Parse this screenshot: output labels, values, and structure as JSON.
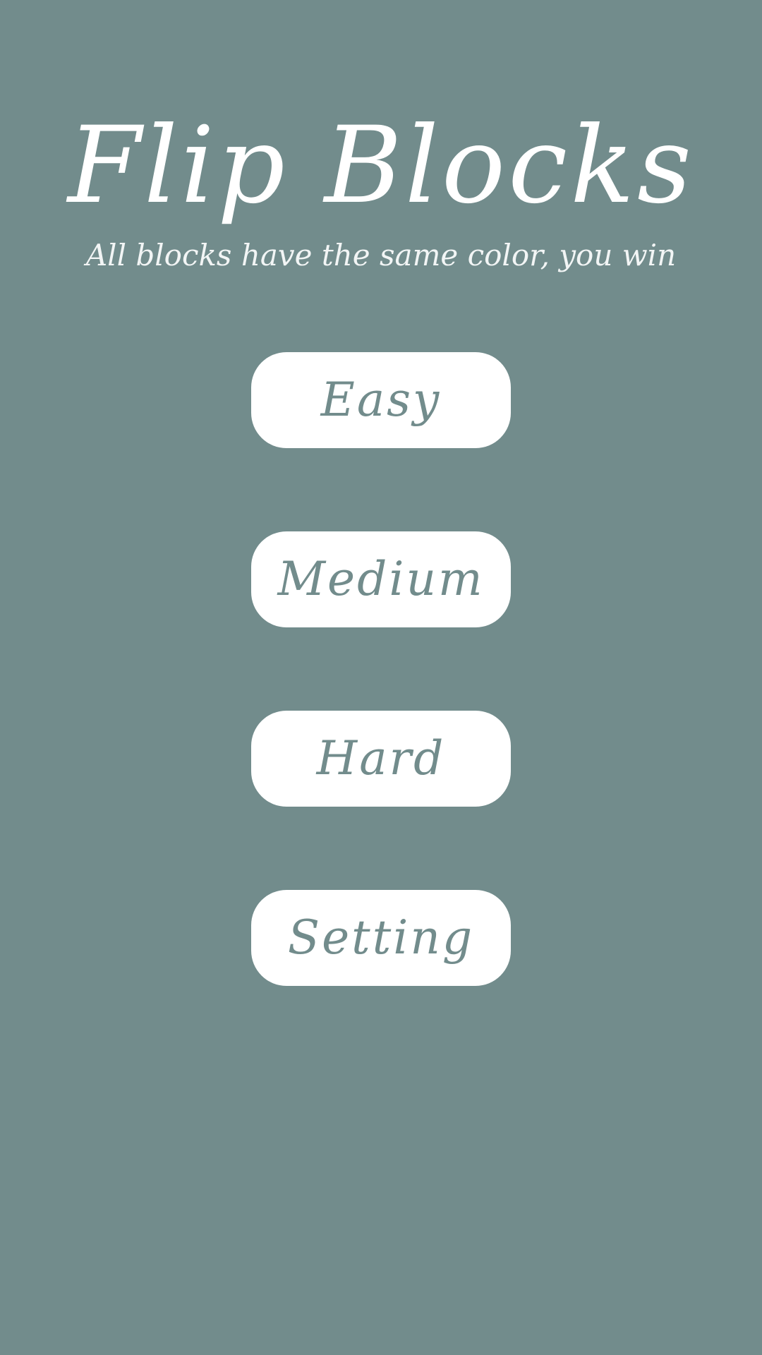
{
  "app": {
    "title": "Flip Blocks",
    "subtitle": "All blocks have the same color, you win"
  },
  "menu": {
    "easy_label": "Easy",
    "medium_label": "Medium",
    "hard_label": "Hard",
    "setting_label": "Setting"
  },
  "colors": {
    "background": "#728c8c",
    "button_background": "#ffffff",
    "button_text": "#728c8c",
    "title_text": "#ffffff"
  }
}
